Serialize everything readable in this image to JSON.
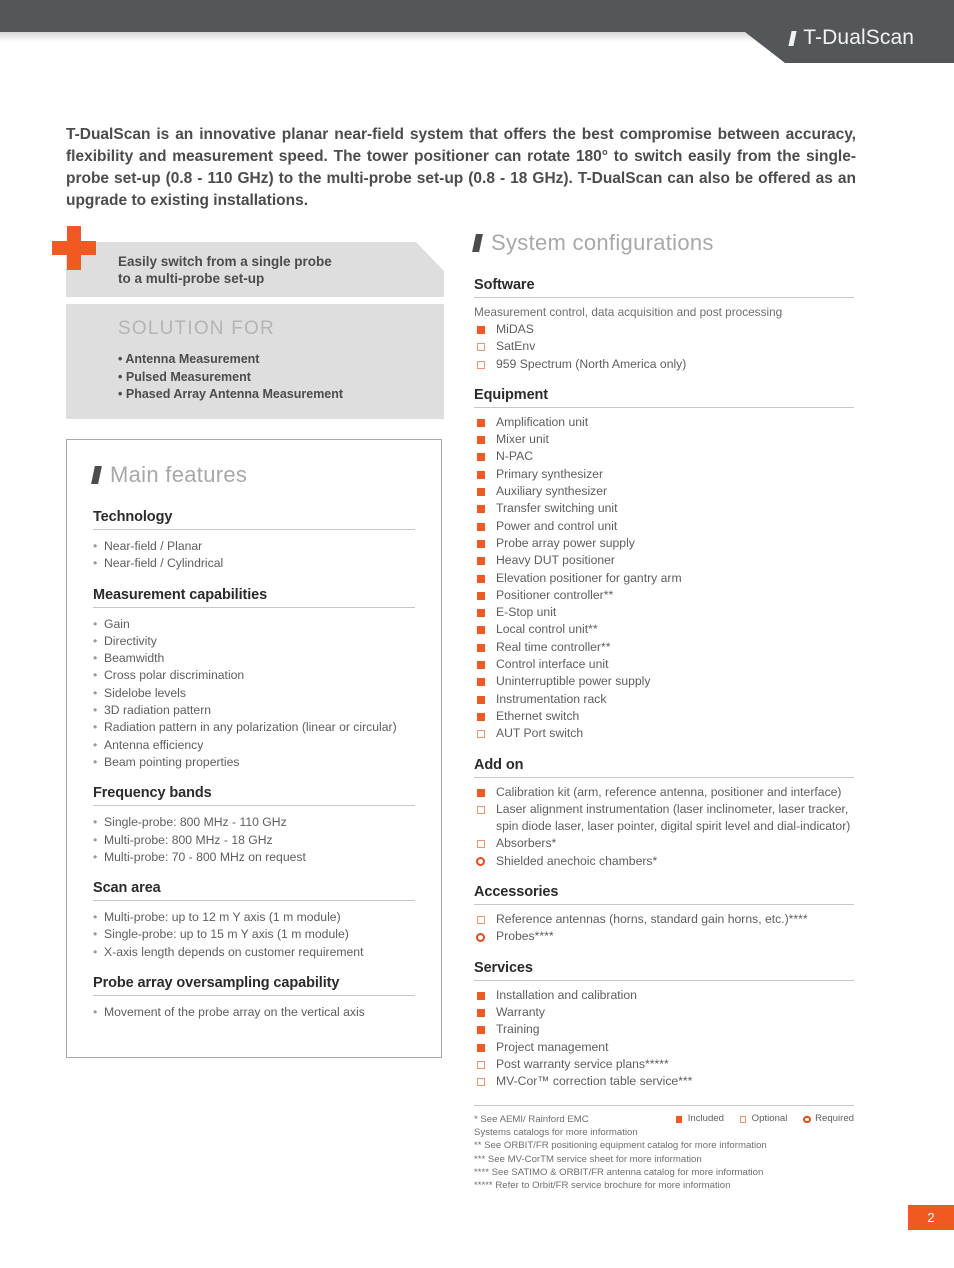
{
  "header": {
    "title": "T-DualScan",
    "slash_icon": "slash-mark-icon"
  },
  "intro": {
    "paragraph": "T-DualScan is an innovative planar near-field system that offers the best compromise between accuracy, flexibility and measurement speed. The tower positioner can rotate 180° to switch easily from the single-probe set-up (0.8 - 110 GHz) to the multi-probe set-up (0.8 - 18 GHz). T-DualScan can also be offered as an upgrade to existing installations."
  },
  "callout": {
    "plus_icon": "plus-icon",
    "text": "Easily switch from a single probe\nto a multi-probe set-up"
  },
  "solution": {
    "title": "SOLUTION FOR",
    "items": [
      "Antenna Measurement",
      "Pulsed Measurement",
      "Phased Array Antenna Measurement"
    ]
  },
  "main_features": {
    "heading": "Main features",
    "sections": [
      {
        "title": "Technology",
        "items": [
          "Near-field / Planar",
          "Near-field / Cylindrical"
        ]
      },
      {
        "title": "Measurement capabilities",
        "items": [
          "Gain",
          "Directivity",
          "Beamwidth",
          "Cross polar discrimination",
          "Sidelobe levels",
          "3D radiation pattern",
          "Radiation pattern in any polarization (linear or circular)",
          "Antenna efficiency",
          "Beam pointing properties"
        ]
      },
      {
        "title": "Frequency bands",
        "items": [
          "Single-probe: 800 MHz - 110 GHz",
          "Multi-probe: 800 MHz - 18 GHz",
          "Multi-probe: 70 - 800 MHz on request"
        ]
      },
      {
        "title": "Scan area",
        "items": [
          "Multi-probe: up to 12 m Y axis (1 m module)",
          "Single-probe: up to 15 m Y axis (1 m module)",
          "X-axis length depends on customer requirement"
        ]
      },
      {
        "title": "Probe array oversampling capability",
        "items": [
          "Movement of the probe array on the vertical axis"
        ]
      }
    ]
  },
  "system_configurations": {
    "heading": "System configurations",
    "software": {
      "title": "Software",
      "note": "Measurement control, data acquisition and post processing",
      "items": [
        {
          "label": "MiDAS",
          "status": "included"
        },
        {
          "label": "SatEnv",
          "status": "optional"
        },
        {
          "label": "959 Spectrum (North America only)",
          "status": "optional"
        }
      ]
    },
    "equipment": {
      "title": "Equipment",
      "items": [
        {
          "label": "Amplification unit",
          "status": "included"
        },
        {
          "label": "Mixer unit",
          "status": "included"
        },
        {
          "label": "N-PAC",
          "status": "included"
        },
        {
          "label": "Primary synthesizer",
          "status": "included"
        },
        {
          "label": "Auxiliary synthesizer",
          "status": "included"
        },
        {
          "label": "Transfer switching unit",
          "status": "included"
        },
        {
          "label": "Power and control unit",
          "status": "included"
        },
        {
          "label": "Probe array power supply",
          "status": "included"
        },
        {
          "label": "Heavy DUT positioner",
          "status": "included"
        },
        {
          "label": "Elevation positioner for gantry arm",
          "status": "included"
        },
        {
          "label": "Positioner controller**",
          "status": "included"
        },
        {
          "label": "E-Stop unit",
          "status": "included"
        },
        {
          "label": "Local control unit**",
          "status": "included"
        },
        {
          "label": "Real time controller**",
          "status": "included"
        },
        {
          "label": "Control interface unit",
          "status": "included"
        },
        {
          "label": "Uninterruptible power supply",
          "status": "included"
        },
        {
          "label": "Instrumentation rack",
          "status": "included"
        },
        {
          "label": "Ethernet switch",
          "status": "included"
        },
        {
          "label": "AUT Port switch",
          "status": "optional"
        }
      ]
    },
    "add_on": {
      "title": "Add on",
      "items": [
        {
          "label": "Calibration kit (arm, reference antenna, positioner and interface)",
          "status": "included"
        },
        {
          "label": "Laser alignment instrumentation (laser inclinometer, laser tracker, spin diode laser, laser pointer, digital spirit level and dial-indicator)",
          "status": "optional"
        },
        {
          "label": "Absorbers*",
          "status": "optional"
        },
        {
          "label": "Shielded anechoic chambers*",
          "status": "required"
        }
      ]
    },
    "accessories": {
      "title": "Accessories",
      "items": [
        {
          "label": "Reference antennas (horns, standard gain horns, etc.)****",
          "status": "optional"
        },
        {
          "label": "Probes****",
          "status": "required"
        }
      ]
    },
    "services": {
      "title": "Services",
      "items": [
        {
          "label": "Installation and calibration",
          "status": "included"
        },
        {
          "label": "Warranty",
          "status": "included"
        },
        {
          "label": "Training",
          "status": "included"
        },
        {
          "label": "Project management",
          "status": "included"
        },
        {
          "label": "Post warranty service plans*****",
          "status": "optional"
        },
        {
          "label": "MV-Cor™ correction table service***",
          "status": "optional"
        }
      ]
    }
  },
  "footnotes": {
    "lines": [
      "* See AEMI/ Rainford EMC",
      "  Systems catalogs for more information",
      "** See ORBIT/FR positioning equipment catalog for more information",
      "*** See MV-CorTM service sheet for more information",
      "**** See SATIMO & ORBIT/FR antenna catalog for more information",
      "***** Refer to Orbit/FR service brochure for more information"
    ],
    "legend": [
      {
        "label": "Included",
        "status": "included"
      },
      {
        "label": "Optional",
        "status": "optional"
      },
      {
        "label": "Required",
        "status": "required"
      }
    ]
  },
  "page_number": "2",
  "colors": {
    "accent_orange": "#f05a22",
    "header_gray": "#555659",
    "panel_gray": "#dededf",
    "text_dark": "#4c4c4e",
    "required_orange": "#e8491a",
    "optional_orange": "#f3936a"
  }
}
